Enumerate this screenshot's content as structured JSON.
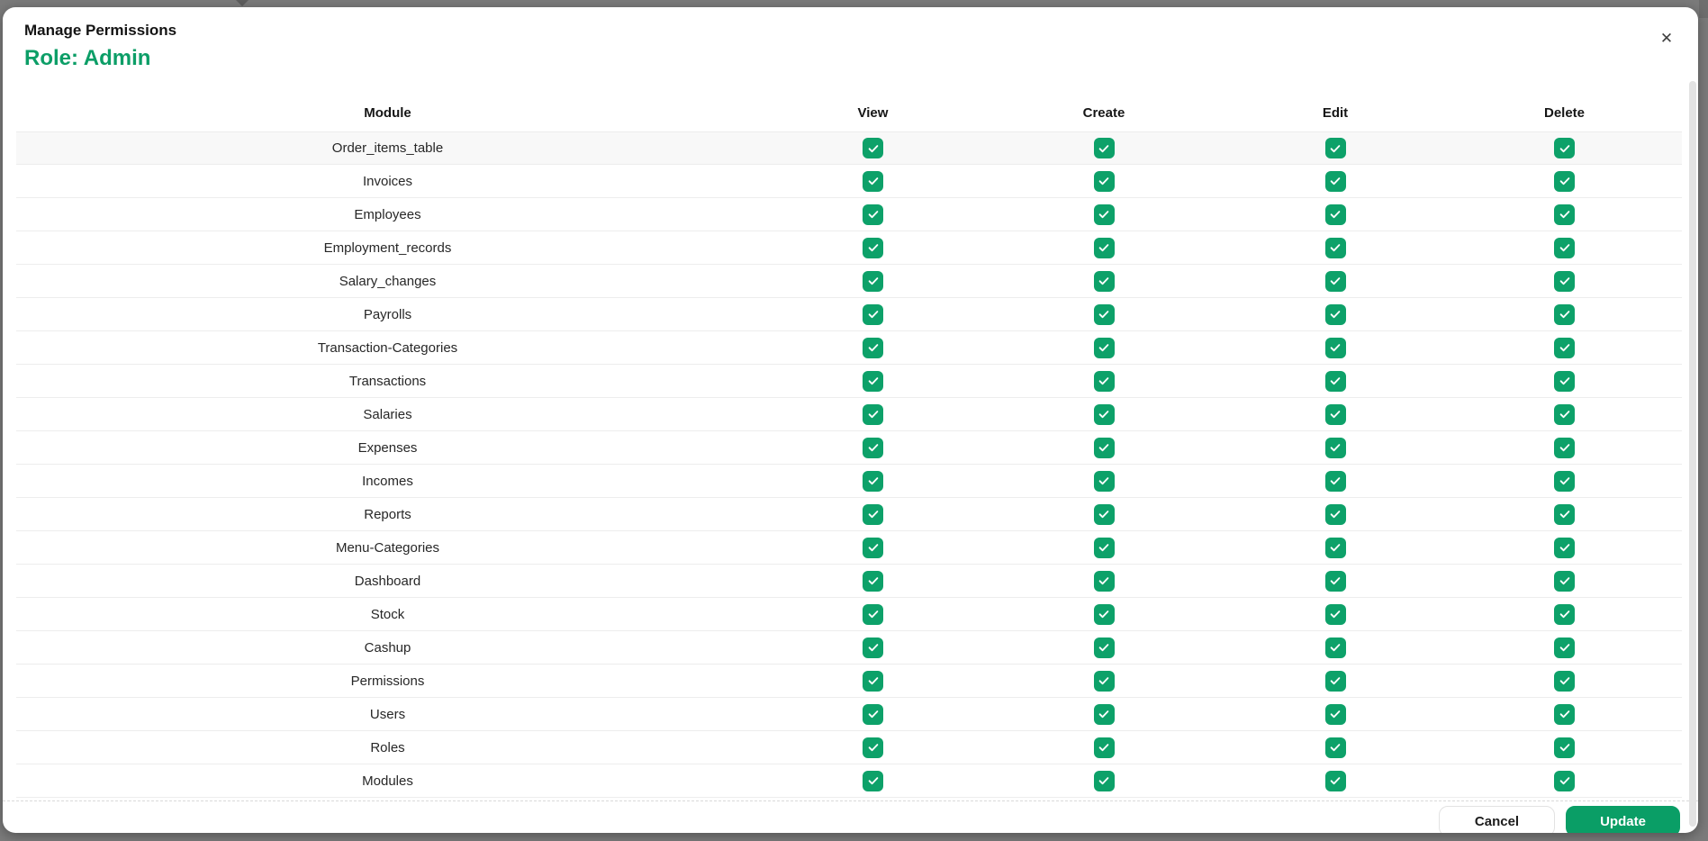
{
  "modal": {
    "title": "Manage Permissions",
    "subtitle": "Role: Admin",
    "close_glyph": "✕"
  },
  "table": {
    "headers": [
      "Module",
      "View",
      "Create",
      "Edit",
      "Delete"
    ],
    "permission_keys": [
      "view",
      "create",
      "edit",
      "delete"
    ],
    "rows": [
      {
        "module": "Order_items_table",
        "permissions": {
          "view": true,
          "create": true,
          "edit": true,
          "delete": true
        }
      },
      {
        "module": "Invoices",
        "permissions": {
          "view": true,
          "create": true,
          "edit": true,
          "delete": true
        }
      },
      {
        "module": "Employees",
        "permissions": {
          "view": true,
          "create": true,
          "edit": true,
          "delete": true
        }
      },
      {
        "module": "Employment_records",
        "permissions": {
          "view": true,
          "create": true,
          "edit": true,
          "delete": true
        }
      },
      {
        "module": "Salary_changes",
        "permissions": {
          "view": true,
          "create": true,
          "edit": true,
          "delete": true
        }
      },
      {
        "module": "Payrolls",
        "permissions": {
          "view": true,
          "create": true,
          "edit": true,
          "delete": true
        }
      },
      {
        "module": "Transaction-Categories",
        "permissions": {
          "view": true,
          "create": true,
          "edit": true,
          "delete": true
        }
      },
      {
        "module": "Transactions",
        "permissions": {
          "view": true,
          "create": true,
          "edit": true,
          "delete": true
        }
      },
      {
        "module": "Salaries",
        "permissions": {
          "view": true,
          "create": true,
          "edit": true,
          "delete": true
        }
      },
      {
        "module": "Expenses",
        "permissions": {
          "view": true,
          "create": true,
          "edit": true,
          "delete": true
        }
      },
      {
        "module": "Incomes",
        "permissions": {
          "view": true,
          "create": true,
          "edit": true,
          "delete": true
        }
      },
      {
        "module": "Reports",
        "permissions": {
          "view": true,
          "create": true,
          "edit": true,
          "delete": true
        }
      },
      {
        "module": "Menu-Categories",
        "permissions": {
          "view": true,
          "create": true,
          "edit": true,
          "delete": true
        }
      },
      {
        "module": "Dashboard",
        "permissions": {
          "view": true,
          "create": true,
          "edit": true,
          "delete": true
        }
      },
      {
        "module": "Stock",
        "permissions": {
          "view": true,
          "create": true,
          "edit": true,
          "delete": true
        }
      },
      {
        "module": "Cashup",
        "permissions": {
          "view": true,
          "create": true,
          "edit": true,
          "delete": true
        }
      },
      {
        "module": "Permissions",
        "permissions": {
          "view": true,
          "create": true,
          "edit": true,
          "delete": true
        }
      },
      {
        "module": "Users",
        "permissions": {
          "view": true,
          "create": true,
          "edit": true,
          "delete": true
        }
      },
      {
        "module": "Roles",
        "permissions": {
          "view": true,
          "create": true,
          "edit": true,
          "delete": true
        }
      },
      {
        "module": "Modules",
        "permissions": {
          "view": true,
          "create": true,
          "edit": true,
          "delete": true
        }
      }
    ]
  },
  "footer": {
    "cancel_label": "Cancel",
    "update_label": "Update"
  },
  "colors": {
    "accent_green": "#0a9e66",
    "checkbox_green": "#0da169",
    "backdrop_gray": "#7b7b7b",
    "first_row_bg": "#f8f8f8",
    "row_border": "#ededed"
  }
}
